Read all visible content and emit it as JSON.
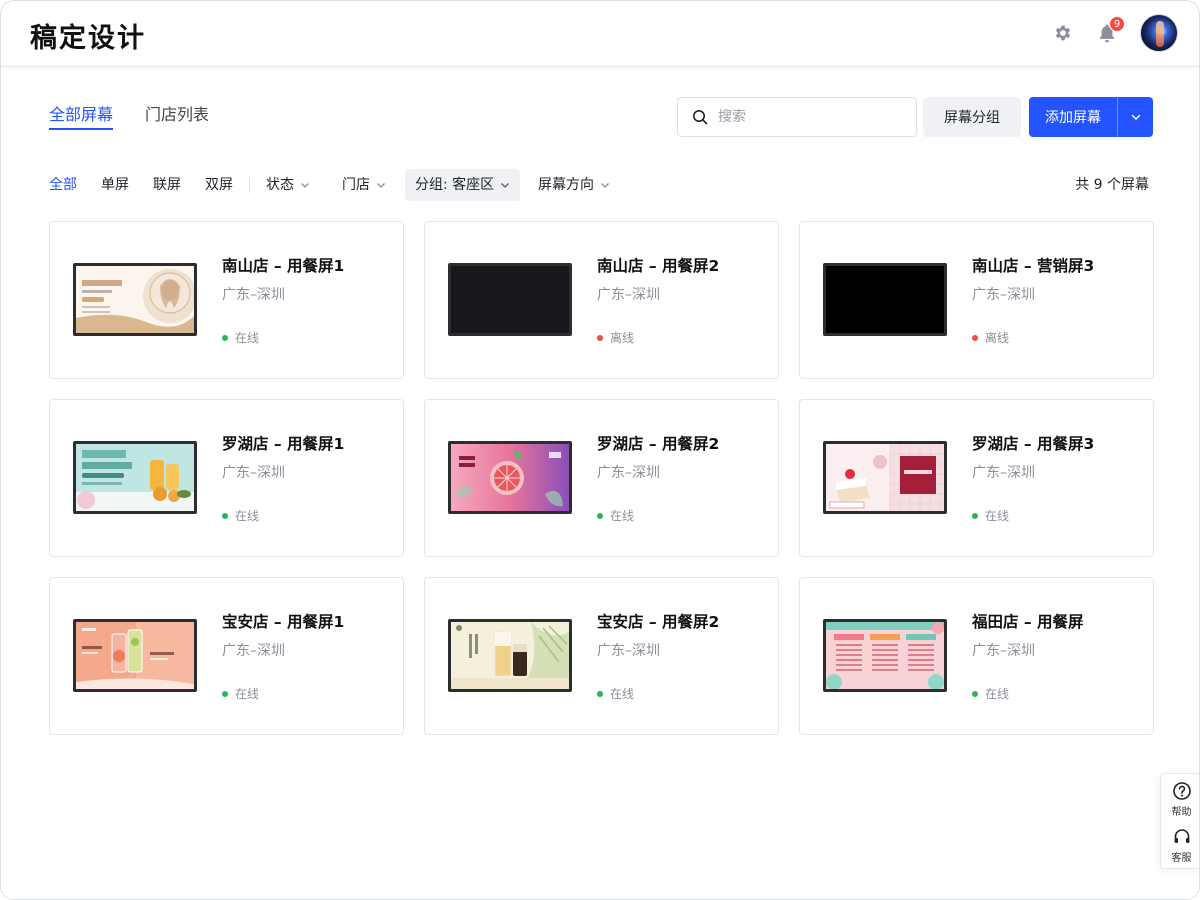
{
  "app": {
    "logo_text": "稿定设计"
  },
  "header": {
    "notification_count": "9"
  },
  "tabs": [
    {
      "label": "全部屏幕",
      "active": true
    },
    {
      "label": "门店列表",
      "active": false
    }
  ],
  "search": {
    "placeholder": "搜索",
    "value": ""
  },
  "actions": {
    "group_label": "屏幕分组",
    "add_label": "添加屏幕"
  },
  "filters": {
    "all": "全部",
    "single": "单屏",
    "linked": "联屏",
    "dual": "双屏",
    "status": "状态",
    "store": "门店",
    "group": "分组: 客座区",
    "orientation": "屏幕方向"
  },
  "count_text": "共 9 个屏幕",
  "status_colors": {
    "online": "#2bb35a",
    "offline": "#f04a3e"
  },
  "screens": [
    {
      "title": "南山店 – 用餐屏1",
      "location": "广东–深圳",
      "status": "在线",
      "state": "online",
      "thumb": "portrait-promo"
    },
    {
      "title": "南山店 – 用餐屏2",
      "location": "广东–深圳",
      "status": "离线",
      "state": "offline",
      "thumb": "blank-dark"
    },
    {
      "title": "南山店 – 营销屏3",
      "location": "广东–深圳",
      "status": "离线",
      "state": "offline",
      "thumb": "blank-black"
    },
    {
      "title": "罗湖店 – 用餐屏1",
      "location": "广东–深圳",
      "status": "在线",
      "state": "online",
      "thumb": "drink-promo"
    },
    {
      "title": "罗湖店 – 用餐屏2",
      "location": "广东–深圳",
      "status": "在线",
      "state": "online",
      "thumb": "grapefruit-promo"
    },
    {
      "title": "罗湖店 – 用餐屏3",
      "location": "广东–深圳",
      "status": "在线",
      "state": "online",
      "thumb": "cake-promo"
    },
    {
      "title": "宝安店 – 用餐屏1",
      "location": "广东–深圳",
      "status": "在线",
      "state": "online",
      "thumb": "juice-orange"
    },
    {
      "title": "宝安店 – 用餐屏2",
      "location": "广东–深圳",
      "status": "在线",
      "state": "online",
      "thumb": "tea-cups"
    },
    {
      "title": "福田店 – 用餐屏",
      "location": "广东–深圳",
      "status": "在线",
      "state": "online",
      "thumb": "menu-board"
    }
  ],
  "side_float": {
    "help_label": "帮助",
    "service_label": "客服"
  }
}
